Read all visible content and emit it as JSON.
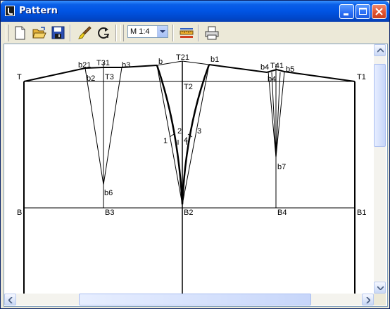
{
  "window": {
    "title": "Pattern"
  },
  "toolbar": {
    "buttons": [
      {
        "icon": "new-document-icon"
      },
      {
        "icon": "open-folder-icon"
      },
      {
        "icon": "save-disk-icon"
      },
      {
        "icon": "brush-icon"
      },
      {
        "icon": "refresh-icon"
      },
      {
        "icon": "ruler-icon"
      },
      {
        "icon": "print-icon"
      }
    ],
    "scale": {
      "selected": "M 1:4"
    }
  },
  "pattern": {
    "labels": {
      "T": "T",
      "T1": "T1",
      "T2": "T2",
      "T3": "T3",
      "T21": "T21",
      "T31": "T31",
      "T41": "T41",
      "b": "b",
      "b1": "b1",
      "b2": "b2",
      "b3": "b3",
      "b4": "b4",
      "b41": "b4",
      "b5": "b5",
      "b6": "b6",
      "b7": "b7",
      "b21": "b21",
      "n1": "1",
      "n2": "2",
      "n3": "3",
      "n4": "4",
      "B": "B",
      "B1": "B1",
      "B2": "B2",
      "B3": "B3",
      "B4": "B4"
    }
  }
}
